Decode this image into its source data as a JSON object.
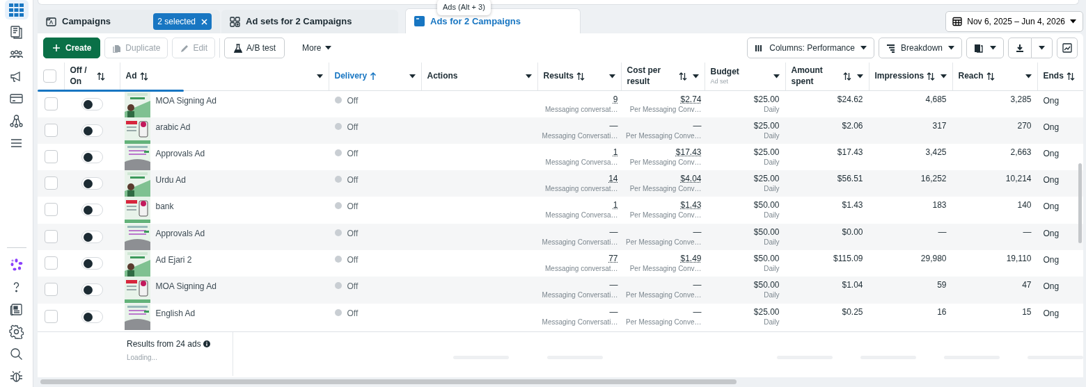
{
  "sidebar": {
    "items": [
      {
        "selected": true
      },
      {
        "selected": false
      },
      {
        "selected": false
      },
      {
        "selected": false
      },
      {
        "selected": false
      },
      {
        "selected": false
      },
      {
        "selected": false
      }
    ],
    "bottom_items": [
      {
        "selected": false
      },
      {
        "selected": false
      },
      {
        "selected": false
      },
      {
        "selected": false
      },
      {
        "selected": false
      },
      {
        "selected": false
      }
    ]
  },
  "tooltip": "Ads (Alt + 3)",
  "tabs": [
    {
      "label": "Campaigns",
      "selected": false,
      "badge": "2 selected"
    },
    {
      "label": "Ad sets for 2 Campaigns",
      "selected": false
    },
    {
      "label": "Ads for 2 Campaigns",
      "selected": true
    }
  ],
  "date_range": "Nov 6, 2025 – Jun 4, 2026",
  "toolbar": [
    {
      "label": "Create",
      "kind": "primary",
      "disabled": false
    },
    {
      "label": "Duplicate",
      "kind": "duplicate",
      "disabled": true
    },
    {
      "label": "Edit",
      "kind": "edit",
      "disabled": true
    },
    {
      "label": "A/B test",
      "kind": "abtest",
      "disabled": false
    },
    {
      "label": "More",
      "kind": "menu",
      "disabled": false
    }
  ],
  "view_controls": [
    {
      "label": "Columns: Performance",
      "kind": "columns"
    },
    {
      "label": "Breakdown",
      "kind": "breakdown"
    }
  ],
  "loading_bar": {
    "level": 0.14
  },
  "select_all": {
    "checked": false
  },
  "columns": [
    {
      "label": "Off / On",
      "sortable": true,
      "sorted": false,
      "menu": false
    },
    {
      "label": "Ad",
      "sortable": true,
      "sorted": false,
      "menu": true
    },
    {
      "label": "Delivery",
      "sortable": false,
      "sorted": true,
      "menu": true
    },
    {
      "label": "Actions",
      "sortable": false,
      "sorted": false,
      "menu": true
    },
    {
      "label": "Results",
      "sortable": true,
      "sorted": false,
      "menu": true
    },
    {
      "label": "Cost per result",
      "sortable": true,
      "sorted": false,
      "menu": true
    },
    {
      "label": "Budget",
      "sublabel": "Ad set",
      "sortable": false,
      "sorted": false,
      "menu": true
    },
    {
      "label": "Amount spent",
      "sortable": true,
      "sorted": false,
      "menu": true
    },
    {
      "label": "Impressions",
      "sortable": true,
      "sorted": false,
      "menu": true
    },
    {
      "label": "Reach",
      "sortable": true,
      "sorted": false,
      "menu": true
    },
    {
      "label": "Ends",
      "sortable": true,
      "sorted": false,
      "menu": false
    }
  ],
  "rows": [
    {
      "checked": false,
      "on": false,
      "name": "MOA Signing Ad",
      "delivery": "Off",
      "results": "9",
      "results_dotted": true,
      "results_label": "Messaging conversat…",
      "cost": "$2.74",
      "cost_dotted": true,
      "cost_label": "Per Messaging Conv…",
      "budget": "$25.00",
      "budget_period": "Daily",
      "amount": "$24.62",
      "impressions": "4,685",
      "reach": "3,285",
      "ends": "Ong"
    },
    {
      "checked": false,
      "on": false,
      "name": "arabic Ad",
      "delivery": "Off",
      "results": "—",
      "results_dotted": false,
      "results_label": "Messaging Conversati…",
      "cost": "—",
      "cost_dotted": false,
      "cost_label": "Per Messaging Conve…",
      "budget": "$25.00",
      "budget_period": "Daily",
      "amount": "$2.06",
      "impressions": "317",
      "reach": "270",
      "ends": "Ong"
    },
    {
      "checked": false,
      "on": false,
      "name": "Approvals Ad",
      "delivery": "Off",
      "results": "1",
      "results_dotted": true,
      "results_label": "Messaging Conversa…",
      "cost": "$17.43",
      "cost_dotted": true,
      "cost_label": "Per Messaging Conv…",
      "budget": "$25.00",
      "budget_period": "Daily",
      "amount": "$17.43",
      "impressions": "3,425",
      "reach": "2,663",
      "ends": "Ong"
    },
    {
      "checked": false,
      "on": false,
      "name": "Urdu Ad",
      "delivery": "Off",
      "results": "14",
      "results_dotted": true,
      "results_label": "Messaging conversat…",
      "cost": "$4.04",
      "cost_dotted": true,
      "cost_label": "Per Messaging Conv…",
      "budget": "$25.00",
      "budget_period": "Daily",
      "amount": "$56.51",
      "impressions": "16,252",
      "reach": "10,214",
      "ends": "Ong"
    },
    {
      "checked": false,
      "on": false,
      "name": "bank",
      "delivery": "Off",
      "results": "1",
      "results_dotted": true,
      "results_label": "Messaging Conversa…",
      "cost": "$1.43",
      "cost_dotted": true,
      "cost_label": "Per Messaging Conv…",
      "budget": "$50.00",
      "budget_period": "Daily",
      "amount": "$1.43",
      "impressions": "183",
      "reach": "140",
      "ends": "Ong"
    },
    {
      "checked": false,
      "on": false,
      "name": "Approvals Ad",
      "delivery": "Off",
      "results": "—",
      "results_dotted": false,
      "results_label": "Messaging Conversati…",
      "cost": "—",
      "cost_dotted": false,
      "cost_label": "Per Messaging Conve…",
      "budget": "$50.00",
      "budget_period": "Daily",
      "amount": "$0.00",
      "impressions": "—",
      "reach": "—",
      "ends": "Ong"
    },
    {
      "checked": false,
      "on": false,
      "name": "Ad Ejari 2",
      "delivery": "Off",
      "results": "77",
      "results_dotted": true,
      "results_label": "Messaging conversat…",
      "cost": "$1.49",
      "cost_dotted": true,
      "cost_label": "Per Messaging Conv…",
      "budget": "$50.00",
      "budget_period": "Daily",
      "amount": "$115.09",
      "impressions": "29,980",
      "reach": "19,110",
      "ends": "Ong"
    },
    {
      "checked": false,
      "on": false,
      "name": "MOA Signing Ad",
      "delivery": "Off",
      "results": "—",
      "results_dotted": false,
      "results_label": "Messaging Conversati…",
      "cost": "—",
      "cost_dotted": false,
      "cost_label": "Per Messaging Conve…",
      "budget": "$50.00",
      "budget_period": "Daily",
      "amount": "$1.04",
      "impressions": "59",
      "reach": "47",
      "ends": "Ong"
    },
    {
      "checked": false,
      "on": false,
      "name": "English Ad",
      "delivery": "Off",
      "results": "—",
      "results_dotted": false,
      "results_label": "Messaging Conversati…",
      "cost": "—",
      "cost_dotted": false,
      "cost_label": "Per Messaging Conve…",
      "budget": "$25.00",
      "budget_period": "Daily",
      "amount": "$0.25",
      "impressions": "16",
      "reach": "15",
      "ends": "Ong"
    }
  ],
  "footer": {
    "summary": "Results from 24 ads",
    "status": "Loading..."
  }
}
